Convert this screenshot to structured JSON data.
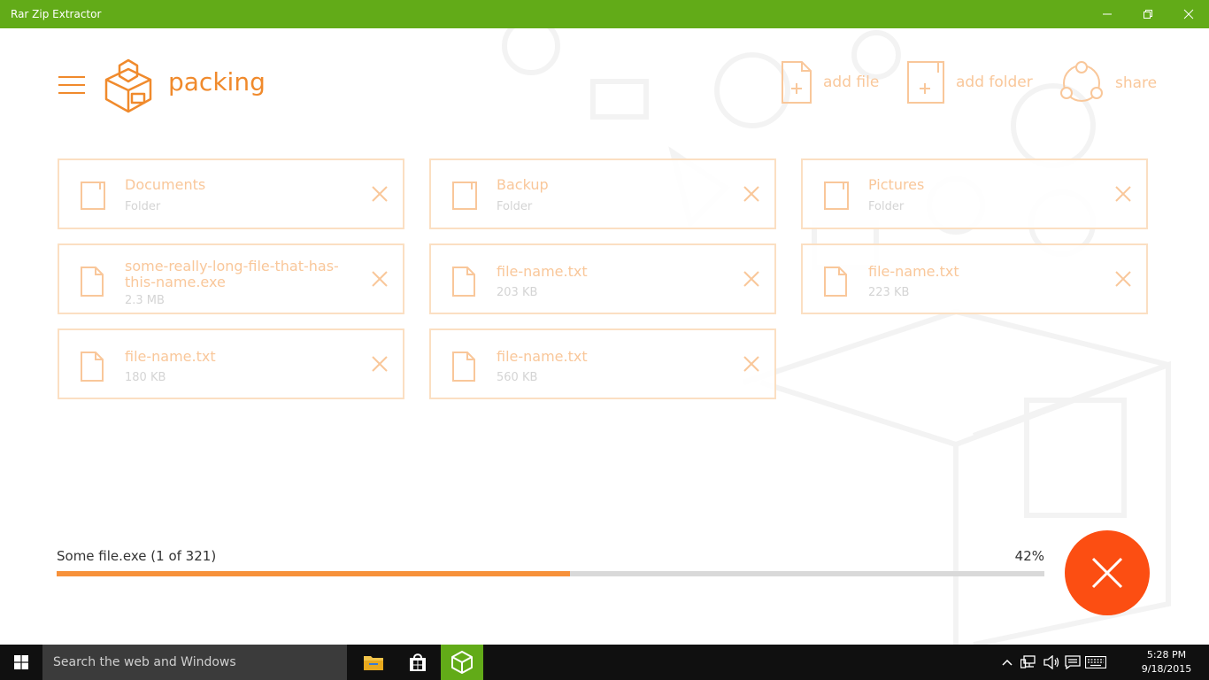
{
  "window": {
    "title": "Rar Zip Extractor",
    "accent": "#62ab18"
  },
  "header": {
    "menu_icon": "hamburger-icon",
    "logo_icon": "package-box-icon",
    "title": "packing",
    "actions": [
      {
        "label": "add file",
        "icon": "add-file-icon"
      },
      {
        "label": "add folder",
        "icon": "add-folder-icon"
      },
      {
        "label": "share",
        "icon": "share-icon"
      }
    ]
  },
  "items": [
    {
      "name": "Documents",
      "sub": "Folder",
      "kind": "folder"
    },
    {
      "name": "Backup",
      "sub": "Folder",
      "kind": "folder"
    },
    {
      "name": "Pictures",
      "sub": "Folder",
      "kind": "folder"
    },
    {
      "name": "some-really-long-file-that-has-this-name.exe",
      "sub": "2.3 MB",
      "kind": "file"
    },
    {
      "name": "file-name.txt",
      "sub": "203 KB",
      "kind": "file"
    },
    {
      "name": "file-name.txt",
      "sub": "223 KB",
      "kind": "file"
    },
    {
      "name": "file-name.txt",
      "sub": "180 KB",
      "kind": "file"
    },
    {
      "name": "file-name.txt",
      "sub": "560 KB",
      "kind": "file"
    }
  ],
  "progress": {
    "label": "Some file.exe (1 of 321)",
    "percent_text": "42%",
    "percent": 52,
    "bar_color": "#f7913a"
  },
  "cancel": {
    "icon": "close-icon",
    "color": "#fc4e12"
  },
  "taskbar": {
    "search_placeholder": "Search the web and Windows",
    "time": "5:28 PM",
    "date": "9/18/2015"
  }
}
